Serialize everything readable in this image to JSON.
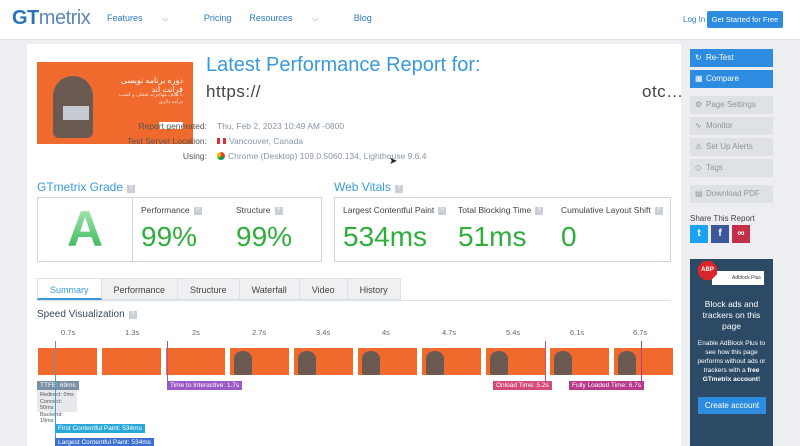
{
  "nav": {
    "logo_gt": "GT",
    "logo_metrix": "metrix",
    "items": [
      "Features",
      "Pricing",
      "Resources",
      "Blog"
    ],
    "login": "Log In",
    "get_started": "Get Started for Free"
  },
  "report": {
    "title": "Latest Performance Report for:",
    "url_start": "https://",
    "url_end": "otc…",
    "thumbnail": {
      "headline": "دوره برنامه نویسی فرانت اند",
      "subtext": "با هدف مهاجرت شغلی و کسب درآمد دلاری"
    },
    "meta": [
      {
        "label": "Report generated:",
        "value": "Thu, Feb 2, 2023 10:49 AM -0800"
      },
      {
        "label": "Test Server Location:",
        "value": "Vancouver, Canada"
      },
      {
        "label": "Using:",
        "value": "Chrome (Desktop) 109.0.5060.134, Lighthouse 9.6.4"
      }
    ]
  },
  "grade": {
    "title": "GTmetrix Grade",
    "letter": "A",
    "performance_label": "Performance",
    "performance_value": "99%",
    "structure_label": "Structure",
    "structure_value": "99%"
  },
  "vitals": {
    "title": "Web Vitals",
    "lcp_label": "Largest Contentful Paint",
    "lcp_value": "534ms",
    "tbt_label": "Total Blocking Time",
    "tbt_value": "51ms",
    "cls_label": "Cumulative Layout Shift",
    "cls_value": "0"
  },
  "tabs": [
    "Summary",
    "Performance",
    "Structure",
    "Waterfall",
    "Video",
    "History"
  ],
  "speed": {
    "title": "Speed Visualization",
    "ticks": [
      "0.7s",
      "1.3s",
      "2s",
      "2.7s",
      "3.4s",
      "4s",
      "4.7s",
      "5.4s",
      "6.1s",
      "6.7s"
    ],
    "ttfb": "TTFB: 69ms",
    "ttfb_detail": [
      "Redirect: 0ms",
      "Connect: 50ms",
      "Backend: 19ms"
    ],
    "tti": "Time to Interactive: 1.7s",
    "onload": "Onload Time: 5.2s",
    "fully_loaded": "Fully Loaded Time: 6.7s",
    "fcp": "First Contentful Paint: 534ms",
    "lcp": "Largest Contentful Paint: 534ms",
    "colors": {
      "ttfb": "#7a8fa3",
      "tti": "#9b59c6",
      "onload": "#d64a7a",
      "fully": "#b83a8a",
      "fcp": "#2aa9d8",
      "lcp": "#3b6fd1"
    }
  },
  "sidebar": {
    "retest": "Re-Test",
    "compare": "Compare",
    "page_settings": "Page Settings",
    "monitor": "Monitor",
    "alerts": "Set Up Alerts",
    "tags": "Tags",
    "download": "Download PDF",
    "share_title": "Share This Report"
  },
  "ad": {
    "badge": "ABP",
    "product": "Adblock Plus",
    "headline": "Block ads and trackers on this page",
    "body_1": "Enable AdBlock Plus to see how this page performs without ads or trackers with a",
    "body_bold": "free GTmetrix account!",
    "button": "Create account"
  }
}
